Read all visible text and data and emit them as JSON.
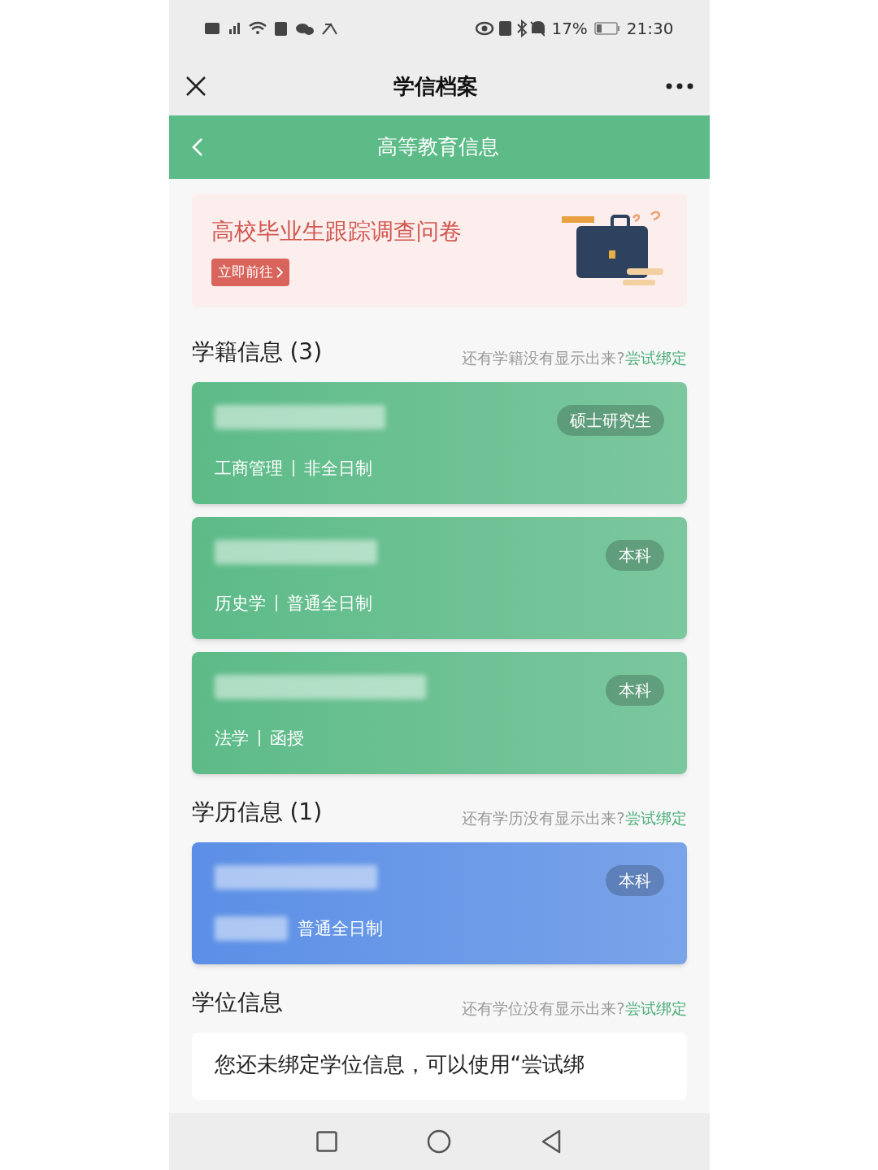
{
  "status_bar": {
    "battery": "17%",
    "time": "21:30"
  },
  "top_bar": {
    "title": "学信档案"
  },
  "header": {
    "title": "高等教育信息"
  },
  "banner": {
    "title": "高校毕业生跟踪调查问卷",
    "button": "立即前往"
  },
  "sections": [
    {
      "title": "学籍信息 (3)",
      "hint": "还有学籍没有显示出来?",
      "link": "尝试绑定",
      "cards": [
        {
          "color": "#5dbb88",
          "badge": "硕士研究生",
          "subtitle": [
            "工商管理",
            "非全日制"
          ]
        },
        {
          "color": "#5dbb88",
          "badge": "本科",
          "subtitle": [
            "历史学",
            "普通全日制"
          ]
        },
        {
          "color": "#5dbb88",
          "badge": "本科",
          "subtitle": [
            "法学",
            "函授"
          ]
        }
      ]
    },
    {
      "title": "学历信息 (1)",
      "hint": "还有学历没有显示出来?",
      "link": "尝试绑定",
      "cards": [
        {
          "color": "#5b8fe6",
          "badge": "本科",
          "subtitle": [
            "普通全日制"
          ],
          "subtitle_blurred": true
        }
      ]
    },
    {
      "title": "学位信息",
      "hint": "还有学位没有显示出来?",
      "link": "尝试绑定",
      "empty_text": "您还未绑定学位信息，可以使用“尝试绑"
    }
  ]
}
